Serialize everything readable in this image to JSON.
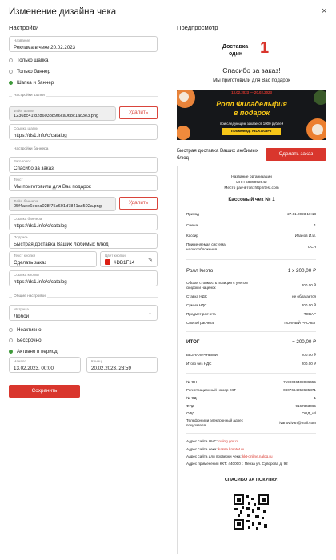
{
  "header": {
    "title": "Изменение дизайна чека",
    "close": "×"
  },
  "settings": {
    "title": "Настройки",
    "name": {
      "label": "Название",
      "value": "Реклама в чеке 20.02.2023"
    },
    "display_modes": [
      {
        "label": "Только шапка",
        "selected": false
      },
      {
        "label": "Только баннер",
        "selected": false
      },
      {
        "label": "Шапка и баннер",
        "selected": true
      }
    ],
    "header_group": "Настройки шапки",
    "header_file": {
      "label": "Файл шапки",
      "value": "1236bc41f828603889f6ca068c1ac3e3.png"
    },
    "delete_label": "Удалить",
    "header_link": {
      "label": "Ссылка шапки",
      "value": "https://ds1.info/c/catalog"
    },
    "banner_group": "Настройки баннера",
    "banner_title": {
      "label": "Заголовок",
      "value": "Спасибо за заказ!"
    },
    "banner_text": {
      "label": "Текст",
      "value": "Мы приготовили для Вас подарок"
    },
    "banner_file": {
      "label": "Файл баннера",
      "value": "05f4aee6ecea028f75a601d7841ac502a.png"
    },
    "banner_link": {
      "label": "Ссылка баннера",
      "value": "https://ds1.info/c/catalog"
    },
    "caption": {
      "label": "Подпись",
      "value": "Быстрая доставка Ваших любимых блюд"
    },
    "button_text": {
      "label": "Текст кнопки",
      "value": "Сделать заказ"
    },
    "button_color": {
      "label": "Цвет кнопки",
      "value": "#DB1F14"
    },
    "button_link": {
      "label": "Ссылка кнопки",
      "value": "https://ds1.info/c/catalog"
    },
    "general_group": "Общие настройки",
    "matrix": {
      "label": "Матрица",
      "value": "Любой"
    },
    "activity": [
      {
        "label": "Неактивно",
        "selected": false
      },
      {
        "label": "Бессрочно",
        "selected": false
      },
      {
        "label": "Активно в период:",
        "selected": true
      }
    ],
    "start": {
      "label": "Начало",
      "value": "13.02.2023, 00:00"
    },
    "end": {
      "label": "Конец",
      "value": "20.02.2023, 23:59"
    },
    "save_label": "Сохранить"
  },
  "preview": {
    "title": "Предпросмотр",
    "logo_line1": "Доставка",
    "logo_line2": "один",
    "logo_num": "1",
    "thanks": "Спасибо за заказ!",
    "gift": "Мы приготовили для Вас подарок",
    "banner": {
      "dates": "13.02.2023 — 20.02.2023",
      "line1": "Ролл Филадельфия",
      "line2": "в подарок",
      "cond": "при следующем заказе от 1000 рублей",
      "promo": "промокод: FILKAGIFT"
    },
    "caption": "Быстрая доставка Ваших любимых блюд",
    "order_btn": "Сделать заказ",
    "receipt": {
      "org": "Название организации",
      "inn": "ИНН 5895052042",
      "place": "Место расчётов: http://test.com",
      "check_title": "Кассовый чек № 1",
      "rows1": [
        {
          "k": "Приход",
          "v": "27.01.2023 10:18"
        },
        {
          "k": "Смена",
          "v": "1"
        },
        {
          "k": "Кассир",
          "v": "Иванов И.И."
        },
        {
          "k": "Применяемая система налогообложения",
          "v": "ОСН"
        }
      ],
      "item": {
        "name": "Ролл Киото",
        "qty": "1 x 200,00 ₽"
      },
      "rows2": [
        {
          "k": "Общая стоимость позиции с учетом скидок и наценок",
          "v": "200.00 ₽"
        },
        {
          "k": "Ставка НДС",
          "v": "не облагается"
        },
        {
          "k": "Сумма НДС",
          "v": "200.00 ₽"
        },
        {
          "k": "Предмет расчета",
          "v": "ТОВАР"
        },
        {
          "k": "Способ расчета",
          "v": "ПОЛНЫЙ РАСЧЕТ"
        }
      ],
      "total_k": "ИТОГ",
      "total_v": "= 200,00 ₽",
      "rows3": [
        {
          "k": "БЕЗНАЛИЧНЫМИ",
          "v": "200.00 ₽"
        },
        {
          "k": "Итого без НДС",
          "v": "200.00 ₽"
        }
      ],
      "rows4": [
        {
          "k": "№ ФН",
          "v": "7199036409086655"
        },
        {
          "k": "Регистрационный номер ККТ",
          "v": "0807664959695871"
        },
        {
          "k": "№ ФД",
          "v": "1"
        },
        {
          "k": "ФПД",
          "v": "9167343065"
        },
        {
          "k": "ОФД",
          "v": "ОФД_url"
        },
        {
          "k": "Телефон или электронный адрес покупателя",
          "v": "ivanov.ivan@mail.com"
        }
      ],
      "fns_k": "Адрес сайта ФНС:",
      "fns_v": "nalog.gov.ru",
      "site_k": "Адрес сайта чека:",
      "site_v": "kassa.komtet.ru",
      "check_k": "Адрес сайта для проверки чека:",
      "check_v": "kkt-online.nalog.ru",
      "addr": "Адрес применения ККТ: 440000 г. Пенза ул. Суворова д. 92",
      "thanks": "СПАСИБО ЗА ПОКУПКУ!"
    }
  },
  "colors": {
    "accent": "#D9362D",
    "green": "#3F9A3A",
    "swatch": "#DB1F14"
  }
}
